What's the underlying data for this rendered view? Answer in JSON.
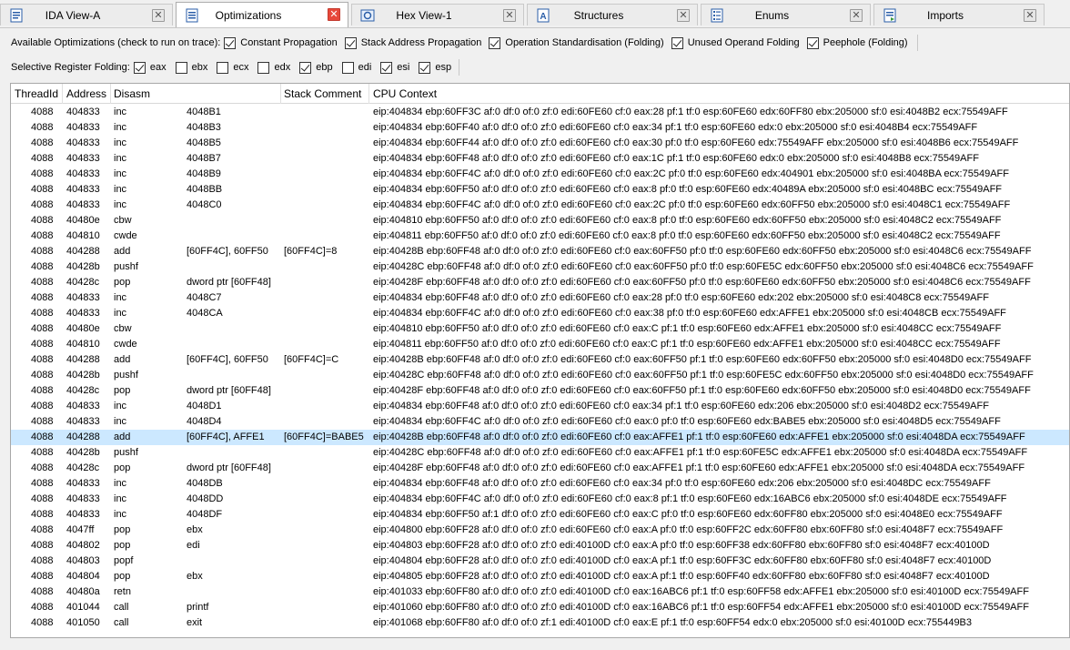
{
  "tabs": [
    {
      "label": "IDA View-A",
      "icon": "ida-view-icon",
      "active": false
    },
    {
      "label": "Optimizations",
      "icon": "list-view-icon",
      "active": true
    },
    {
      "label": "Hex View-1",
      "icon": "hex-view-icon",
      "active": false
    },
    {
      "label": "Structures",
      "icon": "structures-icon",
      "active": false
    },
    {
      "label": "Enums",
      "icon": "enums-icon",
      "active": false
    },
    {
      "label": "Imports",
      "icon": "imports-icon",
      "active": false
    }
  ],
  "optimizations": {
    "label": "Available Optimizations (check to run on trace):",
    "options": [
      {
        "label": "Constant Propagation",
        "checked": true
      },
      {
        "label": "Stack Address Propagation",
        "checked": true
      },
      {
        "label": "Operation Standardisation (Folding)",
        "checked": true
      },
      {
        "label": "Unused Operand Folding",
        "checked": true
      },
      {
        "label": "Peephole (Folding)",
        "checked": true
      }
    ]
  },
  "register_folding": {
    "label": "Selective Register Folding:",
    "registers": [
      {
        "label": "eax",
        "checked": true
      },
      {
        "label": "ebx",
        "checked": false
      },
      {
        "label": "ecx",
        "checked": false
      },
      {
        "label": "edx",
        "checked": false
      },
      {
        "label": "ebp",
        "checked": true
      },
      {
        "label": "edi",
        "checked": false
      },
      {
        "label": "esi",
        "checked": true
      },
      {
        "label": "esp",
        "checked": true
      }
    ]
  },
  "table": {
    "columns": [
      "ThreadId",
      "Address",
      "Disasm",
      "Stack Comment",
      "CPU Context"
    ],
    "selected_index": 21,
    "rows": [
      [
        "4088",
        "404833",
        "inc",
        "4048B1",
        "",
        "eip:404834 ebp:60FF3C af:0 df:0 of:0 zf:0 edi:60FE60 cf:0 eax:28 pf:1 tf:0 esp:60FE60 edx:60FF80 ebx:205000 sf:0 esi:4048B2 ecx:75549AFF"
      ],
      [
        "4088",
        "404833",
        "inc",
        "4048B3",
        "",
        "eip:404834 ebp:60FF40 af:0 df:0 of:0 zf:0 edi:60FE60 cf:0 eax:34 pf:1 tf:0 esp:60FE60 edx:0 ebx:205000 sf:0 esi:4048B4 ecx:75549AFF"
      ],
      [
        "4088",
        "404833",
        "inc",
        "4048B5",
        "",
        "eip:404834 ebp:60FF44 af:0 df:0 of:0 zf:0 edi:60FE60 cf:0 eax:30 pf:0 tf:0 esp:60FE60 edx:75549AFF ebx:205000 sf:0 esi:4048B6 ecx:75549AFF"
      ],
      [
        "4088",
        "404833",
        "inc",
        "4048B7",
        "",
        "eip:404834 ebp:60FF48 af:0 df:0 of:0 zf:0 edi:60FE60 cf:0 eax:1C pf:1 tf:0 esp:60FE60 edx:0 ebx:205000 sf:0 esi:4048B8 ecx:75549AFF"
      ],
      [
        "4088",
        "404833",
        "inc",
        "4048B9",
        "",
        "eip:404834 ebp:60FF4C af:0 df:0 of:0 zf:0 edi:60FE60 cf:0 eax:2C pf:0 tf:0 esp:60FE60 edx:404901 ebx:205000 sf:0 esi:4048BA ecx:75549AFF"
      ],
      [
        "4088",
        "404833",
        "inc",
        "4048BB",
        "",
        "eip:404834 ebp:60FF50 af:0 df:0 of:0 zf:0 edi:60FE60 cf:0 eax:8 pf:0 tf:0 esp:60FE60 edx:40489A ebx:205000 sf:0 esi:4048BC ecx:75549AFF"
      ],
      [
        "4088",
        "404833",
        "inc",
        "4048C0",
        "",
        "eip:404834 ebp:60FF4C af:0 df:0 of:0 zf:0 edi:60FE60 cf:0 eax:2C pf:0 tf:0 esp:60FE60 edx:60FF50 ebx:205000 sf:0 esi:4048C1 ecx:75549AFF"
      ],
      [
        "4088",
        "40480e",
        "cbw",
        "",
        "",
        "eip:404810 ebp:60FF50 af:0 df:0 of:0 zf:0 edi:60FE60 cf:0 eax:8 pf:0 tf:0 esp:60FE60 edx:60FF50 ebx:205000 sf:0 esi:4048C2 ecx:75549AFF"
      ],
      [
        "4088",
        "404810",
        "cwde",
        "",
        "",
        "eip:404811 ebp:60FF50 af:0 df:0 of:0 zf:0 edi:60FE60 cf:0 eax:8 pf:0 tf:0 esp:60FE60 edx:60FF50 ebx:205000 sf:0 esi:4048C2 ecx:75549AFF"
      ],
      [
        "4088",
        "404288",
        "add",
        "[60FF4C], 60FF50",
        "[60FF4C]=8",
        "eip:40428B ebp:60FF48 af:0 df:0 of:0 zf:0 edi:60FE60 cf:0 eax:60FF50 pf:0 tf:0 esp:60FE60 edx:60FF50 ebx:205000 sf:0 esi:4048C6 ecx:75549AFF"
      ],
      [
        "4088",
        "40428b",
        "pushf",
        "",
        "",
        "eip:40428C ebp:60FF48 af:0 df:0 of:0 zf:0 edi:60FE60 cf:0 eax:60FF50 pf:0 tf:0 esp:60FE5C edx:60FF50 ebx:205000 sf:0 esi:4048C6 ecx:75549AFF"
      ],
      [
        "4088",
        "40428c",
        "pop",
        "dword ptr [60FF48]",
        "",
        "eip:40428F ebp:60FF48 af:0 df:0 of:0 zf:0 edi:60FE60 cf:0 eax:60FF50 pf:0 tf:0 esp:60FE60 edx:60FF50 ebx:205000 sf:0 esi:4048C6 ecx:75549AFF"
      ],
      [
        "4088",
        "404833",
        "inc",
        "4048C7",
        "",
        "eip:404834 ebp:60FF48 af:0 df:0 of:0 zf:0 edi:60FE60 cf:0 eax:28 pf:0 tf:0 esp:60FE60 edx:202 ebx:205000 sf:0 esi:4048C8 ecx:75549AFF"
      ],
      [
        "4088",
        "404833",
        "inc",
        "4048CA",
        "",
        "eip:404834 ebp:60FF4C af:0 df:0 of:0 zf:0 edi:60FE60 cf:0 eax:38 pf:0 tf:0 esp:60FE60 edx:AFFE1 ebx:205000 sf:0 esi:4048CB ecx:75549AFF"
      ],
      [
        "4088",
        "40480e",
        "cbw",
        "",
        "",
        "eip:404810 ebp:60FF50 af:0 df:0 of:0 zf:0 edi:60FE60 cf:0 eax:C pf:1 tf:0 esp:60FE60 edx:AFFE1 ebx:205000 sf:0 esi:4048CC ecx:75549AFF"
      ],
      [
        "4088",
        "404810",
        "cwde",
        "",
        "",
        "eip:404811 ebp:60FF50 af:0 df:0 of:0 zf:0 edi:60FE60 cf:0 eax:C pf:1 tf:0 esp:60FE60 edx:AFFE1 ebx:205000 sf:0 esi:4048CC ecx:75549AFF"
      ],
      [
        "4088",
        "404288",
        "add",
        "[60FF4C], 60FF50",
        "[60FF4C]=C",
        "eip:40428B ebp:60FF48 af:0 df:0 of:0 zf:0 edi:60FE60 cf:0 eax:60FF50 pf:1 tf:0 esp:60FE60 edx:60FF50 ebx:205000 sf:0 esi:4048D0 ecx:75549AFF"
      ],
      [
        "4088",
        "40428b",
        "pushf",
        "",
        "",
        "eip:40428C ebp:60FF48 af:0 df:0 of:0 zf:0 edi:60FE60 cf:0 eax:60FF50 pf:1 tf:0 esp:60FE5C edx:60FF50 ebx:205000 sf:0 esi:4048D0 ecx:75549AFF"
      ],
      [
        "4088",
        "40428c",
        "pop",
        "dword ptr [60FF48]",
        "",
        "eip:40428F ebp:60FF48 af:0 df:0 of:0 zf:0 edi:60FE60 cf:0 eax:60FF50 pf:1 tf:0 esp:60FE60 edx:60FF50 ebx:205000 sf:0 esi:4048D0 ecx:75549AFF"
      ],
      [
        "4088",
        "404833",
        "inc",
        "4048D1",
        "",
        "eip:404834 ebp:60FF48 af:0 df:0 of:0 zf:0 edi:60FE60 cf:0 eax:34 pf:1 tf:0 esp:60FE60 edx:206 ebx:205000 sf:0 esi:4048D2 ecx:75549AFF"
      ],
      [
        "4088",
        "404833",
        "inc",
        "4048D4",
        "",
        "eip:404834 ebp:60FF4C af:0 df:0 of:0 zf:0 edi:60FE60 cf:0 eax:0 pf:0 tf:0 esp:60FE60 edx:BABE5 ebx:205000 sf:0 esi:4048D5 ecx:75549AFF"
      ],
      [
        "4088",
        "404288",
        "add",
        "[60FF4C], AFFE1",
        "[60FF4C]=BABE5",
        "eip:40428B ebp:60FF48 af:0 df:0 of:0 zf:0 edi:60FE60 cf:0 eax:AFFE1 pf:1 tf:0 esp:60FE60 edx:AFFE1 ebx:205000 sf:0 esi:4048DA ecx:75549AFF"
      ],
      [
        "4088",
        "40428b",
        "pushf",
        "",
        "",
        "eip:40428C ebp:60FF48 af:0 df:0 of:0 zf:0 edi:60FE60 cf:0 eax:AFFE1 pf:1 tf:0 esp:60FE5C edx:AFFE1 ebx:205000 sf:0 esi:4048DA ecx:75549AFF"
      ],
      [
        "4088",
        "40428c",
        "pop",
        "dword ptr [60FF48]",
        "",
        "eip:40428F ebp:60FF48 af:0 df:0 of:0 zf:0 edi:60FE60 cf:0 eax:AFFE1 pf:1 tf:0 esp:60FE60 edx:AFFE1 ebx:205000 sf:0 esi:4048DA ecx:75549AFF"
      ],
      [
        "4088",
        "404833",
        "inc",
        "4048DB",
        "",
        "eip:404834 ebp:60FF48 af:0 df:0 of:0 zf:0 edi:60FE60 cf:0 eax:34 pf:0 tf:0 esp:60FE60 edx:206 ebx:205000 sf:0 esi:4048DC ecx:75549AFF"
      ],
      [
        "4088",
        "404833",
        "inc",
        "4048DD",
        "",
        "eip:404834 ebp:60FF4C af:0 df:0 of:0 zf:0 edi:60FE60 cf:0 eax:8 pf:1 tf:0 esp:60FE60 edx:16ABC6 ebx:205000 sf:0 esi:4048DE ecx:75549AFF"
      ],
      [
        "4088",
        "404833",
        "inc",
        "4048DF",
        "",
        "eip:404834 ebp:60FF50 af:1 df:0 of:0 zf:0 edi:60FE60 cf:0 eax:C pf:0 tf:0 esp:60FE60 edx:60FF80 ebx:205000 sf:0 esi:4048E0 ecx:75549AFF"
      ],
      [
        "4088",
        "4047ff",
        "pop",
        "ebx",
        "",
        "eip:404800 ebp:60FF28 af:0 df:0 of:0 zf:0 edi:60FE60 cf:0 eax:A pf:0 tf:0 esp:60FF2C edx:60FF80 ebx:60FF80 sf:0 esi:4048F7 ecx:75549AFF"
      ],
      [
        "4088",
        "404802",
        "pop",
        "edi",
        "",
        "eip:404803 ebp:60FF28 af:0 df:0 of:0 zf:0 edi:40100D cf:0 eax:A pf:0 tf:0 esp:60FF38 edx:60FF80 ebx:60FF80 sf:0 esi:4048F7 ecx:40100D"
      ],
      [
        "4088",
        "404803",
        "popf",
        "",
        "",
        "eip:404804 ebp:60FF28 af:0 df:0 of:0 zf:0 edi:40100D cf:0 eax:A pf:1 tf:0 esp:60FF3C edx:60FF80 ebx:60FF80 sf:0 esi:4048F7 ecx:40100D"
      ],
      [
        "4088",
        "404804",
        "pop",
        "ebx",
        "",
        "eip:404805 ebp:60FF28 af:0 df:0 of:0 zf:0 edi:40100D cf:0 eax:A pf:1 tf:0 esp:60FF40 edx:60FF80 ebx:60FF80 sf:0 esi:4048F7 ecx:40100D"
      ],
      [
        "4088",
        "40480a",
        "retn",
        "",
        "",
        "eip:401033 ebp:60FF80 af:0 df:0 of:0 zf:0 edi:40100D cf:0 eax:16ABC6 pf:1 tf:0 esp:60FF58 edx:AFFE1 ebx:205000 sf:0 esi:40100D ecx:75549AFF"
      ],
      [
        "4088",
        "401044",
        "call",
        "printf",
        "",
        "eip:401060 ebp:60FF80 af:0 df:0 of:0 zf:0 edi:40100D cf:0 eax:16ABC6 pf:1 tf:0 esp:60FF54 edx:AFFE1 ebx:205000 sf:0 esi:40100D ecx:75549AFF"
      ],
      [
        "4088",
        "401050",
        "call",
        "exit",
        "",
        "eip:401068 ebp:60FF80 af:0 df:0 of:0 zf:1 edi:40100D cf:0 eax:E pf:1 tf:0 esp:60FF54 edx:0 ebx:205000 sf:0 esi:40100D ecx:755449B3"
      ]
    ]
  }
}
